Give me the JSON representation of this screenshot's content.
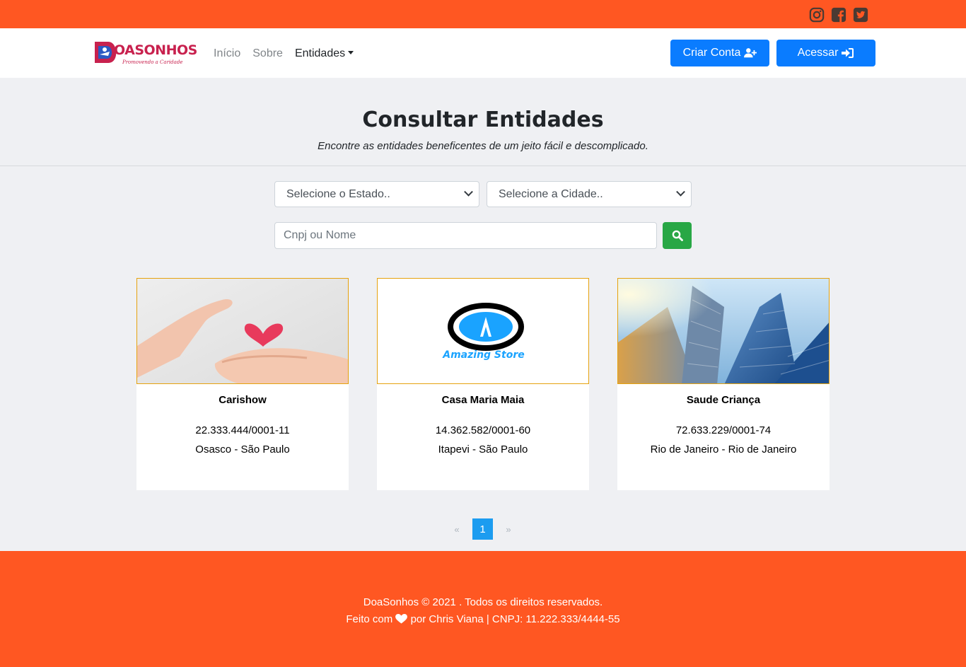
{
  "topbar": {
    "social": [
      {
        "icon": "instagram-icon"
      },
      {
        "icon": "facebook-icon"
      },
      {
        "icon": "twitter-icon"
      }
    ],
    "color": "#ff5722"
  },
  "navbar": {
    "logo": {
      "word": "OASONHOS",
      "tagline": "Promovendo a Caridade"
    },
    "links": [
      "Início",
      "Sobre",
      "Entidades"
    ],
    "create_account": "Criar Conta",
    "login": "Acessar"
  },
  "hero": {
    "title": "Consultar Entidades",
    "subtitle": "Encontre as entidades beneficentes de um jeito fácil e descomplicado."
  },
  "filters": {
    "state": "Selecione o Estado..",
    "city": "Selecione a Cidade..",
    "search_placeholder": "Cnpj ou Nome"
  },
  "cards": [
    {
      "name": "Carishow",
      "cnpj": "22.333.444/0001-11",
      "location": "Osasco - São Paulo",
      "image": "hands-heart-image"
    },
    {
      "name": "Casa Maria Maia",
      "cnpj": "14.362.582/0001-60",
      "location": "Itapevi - São Paulo",
      "image": "amazing-store-logo",
      "logo_text": "Amazing Store"
    },
    {
      "name": "Saude Criança",
      "cnpj": "72.633.229/0001-74",
      "location": "Rio de Janeiro - Rio de Janeiro",
      "image": "skyscrapers-image"
    }
  ],
  "pagination": {
    "prev": "«",
    "current": "1",
    "next": "»"
  },
  "footer": {
    "line1": "DoaSonhos © 2021 . Todos os direitos reservados.",
    "line2_pre": "Feito com",
    "line2_post": "por Chris Viana | CNPJ: 11.222.333/4444-55"
  },
  "colors": {
    "accent": "#ff5722",
    "primary": "#0a7cff",
    "success": "#28a745",
    "card_border": "#e6a20e"
  }
}
